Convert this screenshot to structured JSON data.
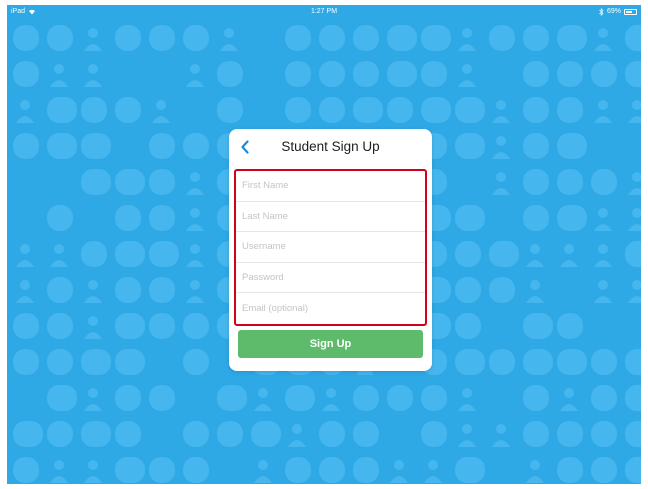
{
  "status_bar": {
    "device": "iPad",
    "wifi_icon": "wifi-icon",
    "time": "1:27 PM",
    "bluetooth_icon": "bluetooth-icon",
    "battery_text": "69%",
    "battery_level": 0.69
  },
  "background": {
    "color": "#2fa8e6",
    "pattern_color": "#45b7ee"
  },
  "card": {
    "back_icon": "chevron-left-icon",
    "title": "Student Sign Up",
    "fields": [
      {
        "name": "first-name-field",
        "placeholder": "First Name"
      },
      {
        "name": "last-name-field",
        "placeholder": "Last Name"
      },
      {
        "name": "username-field",
        "placeholder": "Username"
      },
      {
        "name": "password-field",
        "placeholder": "Password"
      },
      {
        "name": "email-field",
        "placeholder": "Email (optional)"
      }
    ],
    "signup_label": "Sign Up",
    "accent_color": "#1a8cd8",
    "button_color": "#5dbb6b",
    "highlight_color": "#d0021b"
  }
}
